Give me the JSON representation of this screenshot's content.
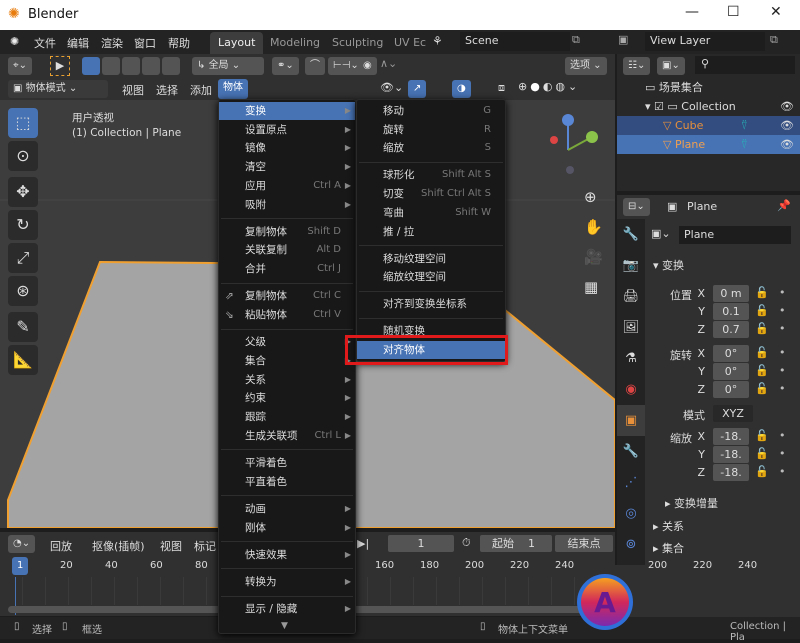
{
  "window": {
    "title": "Blender",
    "min": "—",
    "max": "☐",
    "close": "✕"
  },
  "menubar": {
    "items": [
      "文件",
      "编辑",
      "渲染",
      "窗口",
      "帮助"
    ],
    "tabs": [
      "Layout",
      "Modeling",
      "Sculpting",
      "UV Ec"
    ],
    "scene": "Scene",
    "view_layer": "View Layer"
  },
  "toolbar": {
    "orientation": "全局",
    "options": "选项"
  },
  "header": {
    "mode": "物体模式",
    "view": "视图",
    "select": "选择",
    "add": "添加",
    "object": "物体"
  },
  "viewport": {
    "view_name": "用户透视",
    "context": "(1) Collection | Plane"
  },
  "object_menu": {
    "items": [
      {
        "label": "变换",
        "sub": true,
        "hl": true
      },
      {
        "label": "设置原点",
        "sub": true
      },
      {
        "label": "镜像",
        "sub": true
      },
      {
        "label": "清空",
        "sub": true
      },
      {
        "label": "应用",
        "shortcut": "Ctrl A",
        "sub": true
      },
      {
        "label": "吸附",
        "sub": true
      },
      {
        "sep": true
      },
      {
        "label": "复制物体",
        "shortcut": "Shift D"
      },
      {
        "label": "关联复制",
        "shortcut": "Alt D"
      },
      {
        "label": "合并",
        "shortcut": "Ctrl J"
      },
      {
        "sep": true
      },
      {
        "label": "复制物体",
        "shortcut": "Ctrl C",
        "icon": "copy"
      },
      {
        "label": "粘贴物体",
        "shortcut": "Ctrl V",
        "icon": "paste"
      },
      {
        "sep": true
      },
      {
        "label": "父级",
        "sub": true
      },
      {
        "label": "集合",
        "sub": true
      },
      {
        "label": "关系",
        "sub": true
      },
      {
        "label": "约束",
        "sub": true
      },
      {
        "label": "跟踪",
        "sub": true
      },
      {
        "label": "生成关联项",
        "shortcut": "Ctrl L",
        "sub": true
      },
      {
        "sep": true
      },
      {
        "label": "平滑着色"
      },
      {
        "label": "平直着色"
      },
      {
        "sep": true
      },
      {
        "label": "动画",
        "sub": true
      },
      {
        "label": "刚体",
        "sub": true
      },
      {
        "sep": true
      },
      {
        "label": "快速效果",
        "sub": true
      },
      {
        "sep": true
      },
      {
        "label": "转换为",
        "sub": true
      },
      {
        "sep": true
      },
      {
        "label": "显示 / 隐藏",
        "sub": true
      }
    ],
    "more": "▼"
  },
  "transform_menu": {
    "items": [
      {
        "label": "移动",
        "shortcut": "G"
      },
      {
        "label": "旋转",
        "shortcut": "R"
      },
      {
        "label": "缩放",
        "shortcut": "S"
      },
      {
        "sep": true
      },
      {
        "label": "球形化",
        "shortcut": "Shift Alt S"
      },
      {
        "label": "切变",
        "shortcut": "Shift Ctrl Alt S"
      },
      {
        "label": "弯曲",
        "shortcut": "Shift W"
      },
      {
        "label": "推 / 拉"
      },
      {
        "sep": true
      },
      {
        "label": "移动纹理空间"
      },
      {
        "label": "缩放纹理空间"
      },
      {
        "sep": true
      },
      {
        "label": "对齐到变换坐标系"
      },
      {
        "sep": true
      },
      {
        "label": "随机变换"
      },
      {
        "label": "对齐物体",
        "hl": true
      }
    ]
  },
  "outliner": {
    "root": "场景集合",
    "collection": "Collection",
    "objects": [
      "Cube",
      "Plane"
    ]
  },
  "properties": {
    "object_name": "Plane",
    "data_name": "Plane",
    "section": "变换",
    "location": {
      "label": "位置",
      "x": "0 m",
      "y": "0.1",
      "z": "0.7"
    },
    "rotation": {
      "label": "旋转",
      "x": "0°",
      "y": "0°",
      "z": "0°"
    },
    "mode_label": "模式",
    "mode": "XYZ",
    "scale": {
      "label": "缩放",
      "x": "-18.",
      "y": "-18.",
      "z": "-18."
    },
    "delta": "变换增量",
    "relations": "关系",
    "collections": "集合"
  },
  "timeline": {
    "playback": "回放",
    "keying": "抠像(插帧)",
    "view": "视图",
    "marker": "标记",
    "current": "1",
    "start_label": "起始",
    "start": "1",
    "end_label": "结束点",
    "ticks_left": [
      "20",
      "40",
      "60",
      "80"
    ],
    "ticks_right": [
      "160",
      "180",
      "200",
      "220",
      "240"
    ],
    "ticks_far": [
      "200",
      "220",
      "240"
    ],
    "frame_marker": "1"
  },
  "statusbar": {
    "select": "选择",
    "box": "框选",
    "context_menu": "物体上下文菜单",
    "info": "Collection | Pla"
  },
  "colors": {
    "accent": "#4772b3",
    "highlight_box": "#e0191b",
    "selection_outline": "#f0a030",
    "object": "#e8903a"
  }
}
